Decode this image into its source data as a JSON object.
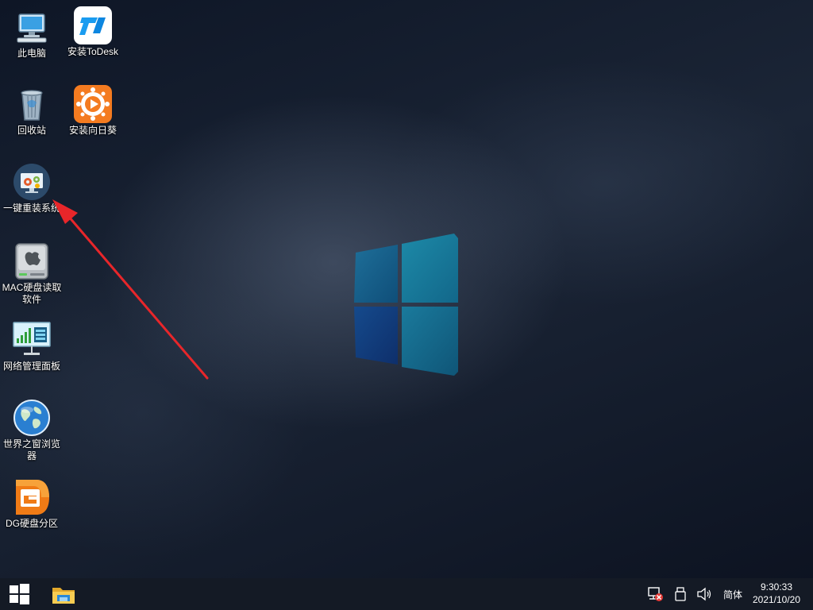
{
  "desktop": {
    "icons": [
      {
        "label": "此电脑",
        "icon": "computer-icon"
      },
      {
        "label": "安装ToDesk",
        "icon": "todesk-icon"
      },
      {
        "label": "回收站",
        "icon": "recycle-bin-icon"
      },
      {
        "label": "安装向日葵",
        "icon": "sunflower-icon"
      },
      {
        "label": "一键重装系统",
        "icon": "reinstall-system-icon"
      },
      {
        "label": "MAC硬盘读取软件",
        "icon": "mac-disk-icon"
      },
      {
        "label": "网络管理面板",
        "icon": "network-panel-icon"
      },
      {
        "label": "世界之窗浏览器",
        "icon": "globe-browser-icon"
      },
      {
        "label": "DG硬盘分区",
        "icon": "diskgenius-icon"
      }
    ]
  },
  "annotation": {
    "color": "#e8262a",
    "target": "一键重装系统"
  },
  "taskbar": {
    "start_icon": "windows-start-icon",
    "pinned": [
      "file-explorer-icon"
    ],
    "tray": {
      "icons": [
        "network-disconnected-icon",
        "usb-drive-icon",
        "volume-icon"
      ],
      "ime": "简体",
      "time": "9:30:33",
      "date": "2021/10/20"
    }
  },
  "colors": {
    "taskbar": "#141a25",
    "logo": "#1a6a94",
    "arrow": "#e8262a"
  }
}
